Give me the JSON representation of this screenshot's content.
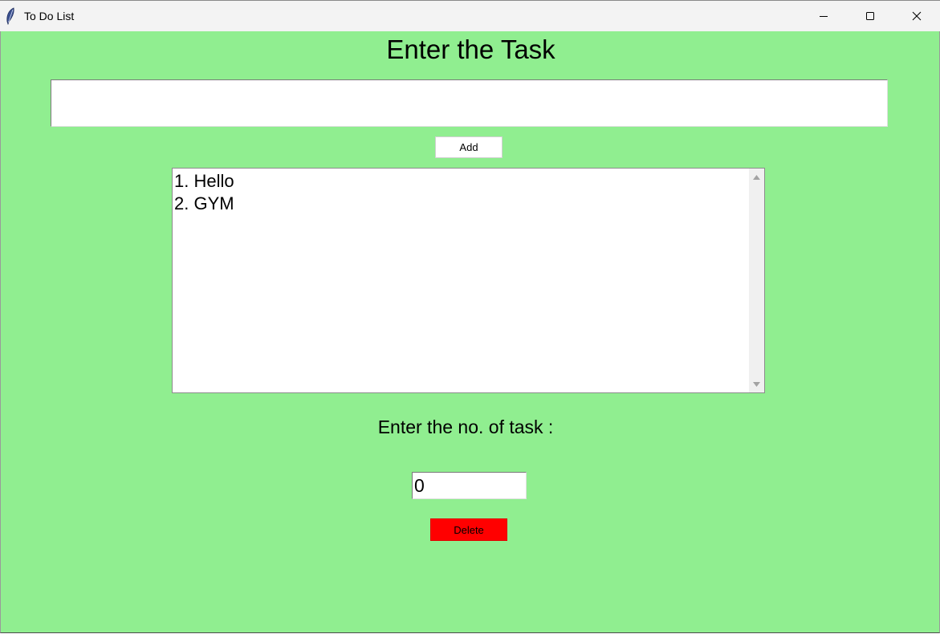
{
  "window": {
    "title": "To Do List",
    "app_icon": "feather-icon",
    "controls": {
      "minimize_icon": "minimize-icon",
      "maximize_icon": "maximize-icon",
      "close_icon": "close-icon"
    }
  },
  "colors": {
    "background": "#90ee90",
    "delete_button": "#ff0000",
    "add_button": "#ffffff",
    "titlebar": "#f3f3f3"
  },
  "main": {
    "heading": "Enter the Task",
    "task_input": {
      "value": "",
      "placeholder": ""
    },
    "add_button_label": "Add",
    "tasks": [
      "1. Hello",
      "2. GYM"
    ],
    "number_label": "Enter the no. of task :",
    "number_input": {
      "value": "0"
    },
    "delete_button_label": "Delete"
  }
}
